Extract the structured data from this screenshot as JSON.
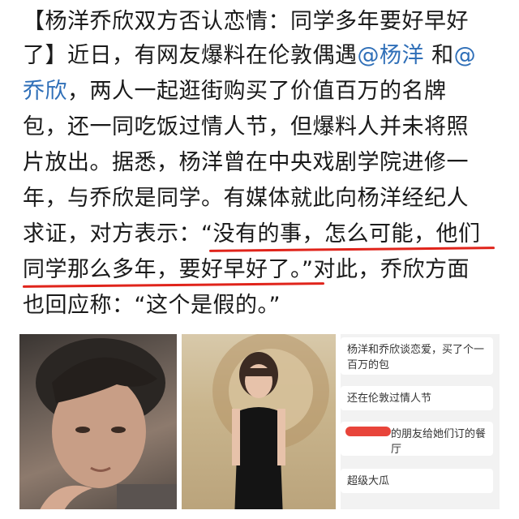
{
  "post": {
    "lines": [
      "【杨洋乔欣双方否认恋情：同学多年要好早好",
      "了】近日，有网友爆料在伦敦偶遇",
      "，两人一起逛街购买了价值百万的名牌",
      "包，还一同吃饭过情人节，但爆料人并未将照",
      "片放出。据悉，杨洋曾在中央戏剧学院进修一",
      "年，与乔欣是同学。有媒体就此向杨洋经纪人",
      "求证，对方表示：“没有的事，怎么可能，他们",
      "同学那么多年，要好早好了。”对此，乔欣方面",
      "也回应称：“这个是假的。”"
    ],
    "mention_yang": "@杨洋",
    "and_word": " 和",
    "mention_at": "@",
    "mention_qiao": "乔欣"
  },
  "chat": {
    "messages": [
      "杨洋和乔欣谈恋爱，买了个一百万的包",
      "还在伦敦过情人节",
      "的朋友给她们订的餐厅",
      "超级大瓜"
    ]
  },
  "colors": {
    "text": "#1a1a1a",
    "mention": "#2f6fb8",
    "underline": "#e0241b"
  }
}
